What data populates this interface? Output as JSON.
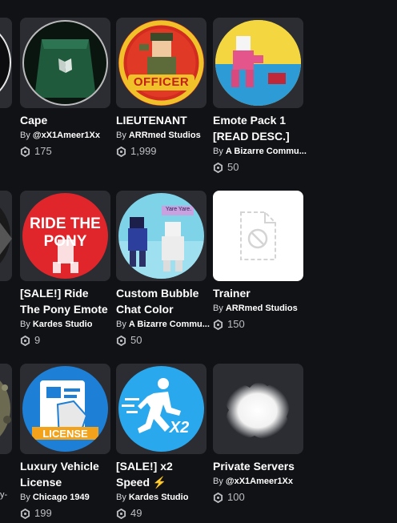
{
  "cards": [
    {
      "name": "Cape",
      "by": "By",
      "creator": "@xX1Ameer1Xx",
      "price": "175"
    },
    {
      "name": "LIEUTENANT",
      "by": "By",
      "creator": "ARRmed Studios",
      "price": "1,999"
    },
    {
      "name": "Emote Pack 1 [READ DESC.]",
      "by": "By",
      "creator": "A Bizarre Commu...",
      "price": "50"
    },
    {
      "name": "[SALE!] Ride The Pony Emote",
      "by": "By",
      "creator": "Kardes Studio",
      "price": "9"
    },
    {
      "name": "Custom Bubble Chat Color",
      "by": "By",
      "creator": "A Bizarre Commu...",
      "price": "50"
    },
    {
      "name": "Trainer",
      "by": "By",
      "creator": "ARRmed Studios",
      "price": "150"
    },
    {
      "name": "Luxury Vehicle License",
      "by": "By",
      "creator": "Chicago 1949",
      "price": "199"
    },
    {
      "name": "[SALE!] x2 Speed ⚡",
      "by": "By",
      "creator": "Kardes Studio",
      "price": "49"
    },
    {
      "name": "Private Servers",
      "by": "By",
      "creator": "@xX1Ameer1Xx",
      "price": "100"
    }
  ],
  "thumb_text": {
    "officer": "OFFICER",
    "ride": "RIDE THE",
    "pony": "PONY",
    "yare": "Yare Yare.",
    "license": "LICENSE",
    "x2": "X2"
  },
  "partial_text": "y-",
  "icons": {
    "currency": "robux-icon",
    "placeholder": "broken-image-icon"
  },
  "colors": {
    "background": "#111216",
    "card": "#2b2d33",
    "pony_red": "#e0262b",
    "speed_blue": "#2aa8ee",
    "license_blue": "#1e7fd6"
  }
}
